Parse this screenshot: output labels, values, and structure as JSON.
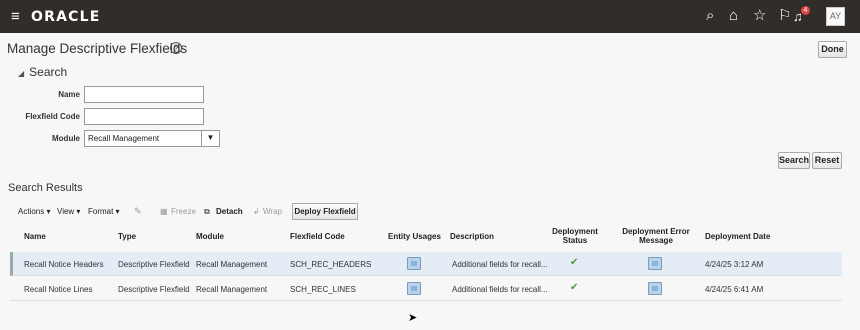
{
  "app": {
    "menu_icon": "≡",
    "logo": "ORACLE"
  },
  "header_icons": {
    "search": "⌕",
    "home": "⌂",
    "favorites": "☆",
    "flag": "⚐",
    "notifications": "♫",
    "notification_count": "4",
    "avatar": "AY"
  },
  "page": {
    "title": "Manage Descriptive Flexfields",
    "help": "?",
    "done_label": "Done"
  },
  "search": {
    "header": "Search",
    "fields": {
      "name_label": "Name",
      "name_value": "",
      "code_label": "Flexfield Code",
      "code_value": "",
      "module_label": "Module",
      "module_value": "Recall Management"
    },
    "search_label": "Search",
    "reset_label": "Reset"
  },
  "results": {
    "title": "Search Results",
    "toolbar": {
      "actions": "Actions ▾",
      "view": "View ▾",
      "format": "Format ▾",
      "freeze": "Freeze",
      "detach": "Detach",
      "wrap": "Wrap",
      "deploy": "Deploy Flexfield"
    },
    "columns": [
      "Name",
      "Type",
      "Module",
      "Flexfield Code",
      "Entity Usages",
      "Description",
      "Deployment Status",
      "Deployment Error Message",
      "Deployment Date"
    ],
    "rows": [
      {
        "name": "Recall Notice Headers",
        "type": "Descriptive Flexfield",
        "module": "Recall Management",
        "code": "SCH_REC_HEADERS",
        "description": "Additional fields for recall...",
        "date": "4/24/25 3:12 AM"
      },
      {
        "name": "Recall Notice Lines",
        "type": "Descriptive Flexfield",
        "module": "Recall Management",
        "code": "SCH_REC_LINES",
        "description": "Additional fields for recall...",
        "date": "4/24/25 6:41 AM"
      }
    ]
  }
}
